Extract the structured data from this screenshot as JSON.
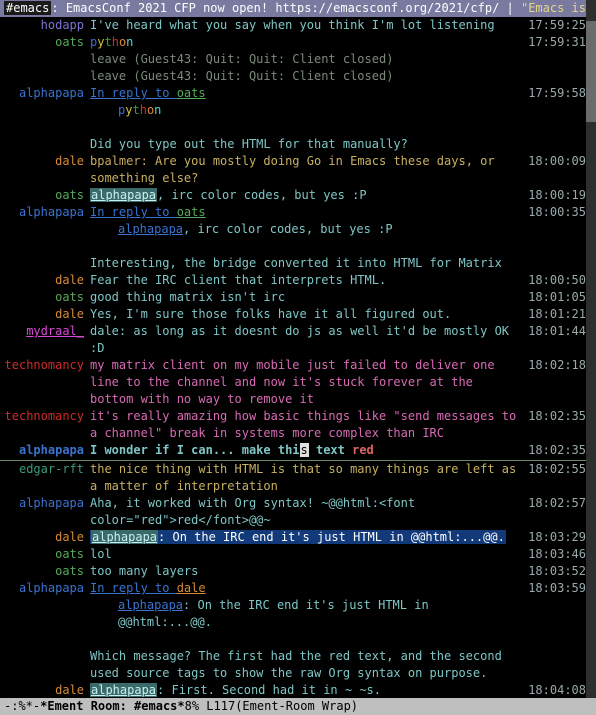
{
  "header": {
    "channel": "#emacs",
    "sep": ": ",
    "topic_a": "EmacsConf 2021 CFP now open! https://emacsconf.org/2021/cfp/ ",
    "topic_b": "| ",
    "topic_c": "\"Emacs is a co"
  },
  "nicks": {
    "hodapp": "hodapp",
    "oats": "oats",
    "alphapapa": "alphapapa",
    "dale": "dale",
    "mydraal": "mydraal_",
    "technomancy": "technomancy",
    "edgar": "edgar-rft",
    "bpalmer": "bpalmer"
  },
  "strings": {
    "reply_to": "In reply to ",
    "python": {
      "p": "p",
      "y": "y",
      "t": "t",
      "h": "h",
      "o": "o",
      "n": "n"
    },
    "irc_codes": ", irc color codes, but yes :P",
    "alphapapa_hl": "alphapapa",
    "alphapapa_b": "alphapapa",
    "on_irc_end": ": On the IRC end it's just HTML in @@html:...@@.",
    "on_irc_end2": ": On the IRC end it's just HTML in @@html:...@@.",
    "first_second": ": First. Second had it in ~ ~s.",
    "colon": ": "
  },
  "lines": {
    "l0": {
      "ts": "17:59:25",
      "msg": "I've heard what you say when you think I'm lot listening"
    },
    "l1": {
      "ts": "17:59:31"
    },
    "l2": {
      "sys": "leave (Guest43: Quit: Quit: Client closed)"
    },
    "l3": {
      "sys": "leave (Guest43: Quit: Quit: Client closed)"
    },
    "l4": {
      "ts": "17:59:58"
    },
    "l5": {
      "msg": "Did you type out the HTML for that manually?"
    },
    "l6": {
      "ts": "18:00:09",
      "msg": "Are you mostly doing Go in Emacs these days, or something else?"
    },
    "l7": {
      "ts": "18:00:19"
    },
    "l8": {
      "ts": "18:00:35"
    },
    "l9": {
      "msg": "Interesting, the bridge converted it into HTML for Matrix"
    },
    "l10": {
      "ts": "18:00:50",
      "msg": "Fear the IRC client that interprets HTML."
    },
    "l11": {
      "ts": "18:01:05",
      "msg": "good thing matrix isn't irc"
    },
    "l12": {
      "ts": "18:01:21",
      "msg": "Yes, I'm sure those folks have it all figured out."
    },
    "l13": {
      "ts": "18:01:44",
      "msg": "dale: as long as it doesnt do js as well it'd be mostly OK :D"
    },
    "l14": {
      "ts": "18:02:18",
      "msg": "my matrix client on my mobile just failed to deliver one line to the channel and now it's stuck forever at the bottom with no way to remove it"
    },
    "l15": {
      "ts": "18:02:35",
      "msg": "it's really amazing how basic things like \"send messages to a channel\" break in systems more complex than IRC"
    },
    "l16": {
      "ts": "18:02:35",
      "pre": "I wonder if I can... make thi",
      "cur": "s",
      "mid": " text ",
      "red": "red"
    },
    "l17": {
      "ts": "18:02:55",
      "msg": "the nice thing with HTML is that so many things are left as a matter of interpretation"
    },
    "l18": {
      "ts": "18:02:57",
      "msg": "Aha, it worked with Org syntax!  ~@@html:<font color=\"red\">red</font>@@~"
    },
    "l19": {
      "ts": "18:03:29"
    },
    "l20": {
      "ts": "18:03:46",
      "msg": "lol"
    },
    "l21": {
      "ts": "18:03:52",
      "msg": "too many layers"
    },
    "l22": {
      "ts": "18:03:59"
    },
    "l23": {
      "msg": "Which message? The first had the red text, and the second used source tags to show the raw Org syntax on purpose."
    },
    "l24": {
      "ts": "18:04:08"
    }
  },
  "modeline": {
    "left": "-:%*-  ",
    "buf": "*Ement Room: #emacs*",
    "mid": "   8% L117   ",
    "mode": "(Ement-Room Wrap)"
  },
  "scrollbar": {
    "top_pct": 3,
    "height_pct": 14
  }
}
